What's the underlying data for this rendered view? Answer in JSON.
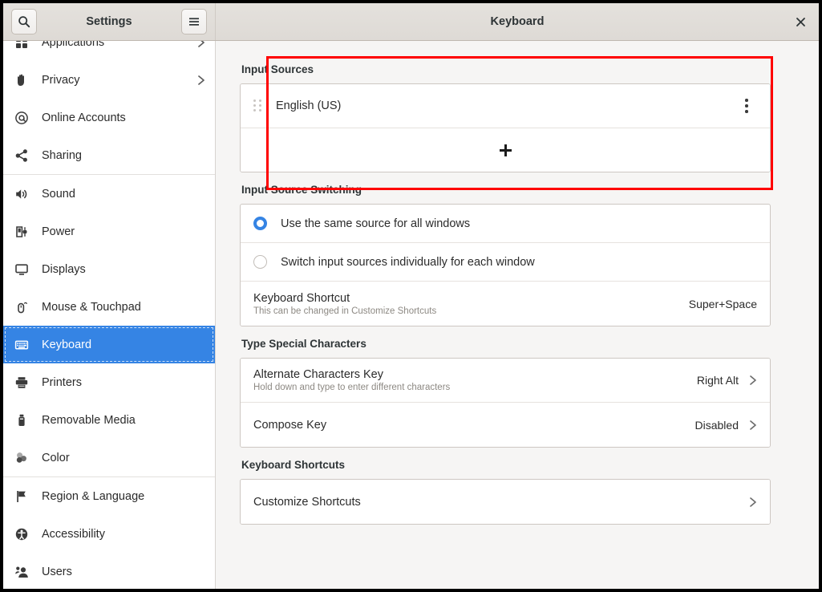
{
  "window": {
    "sidebar_header_title": "Settings",
    "content_header_title": "Keyboard",
    "search_icon": "search-icon",
    "menu_icon": "hamburger-menu-icon",
    "close_icon": "close-icon",
    "accent_color": "#3584e4",
    "highlight_color": "#ff0000"
  },
  "sidebar": {
    "items": [
      {
        "label": "Applications",
        "icon": "applications-icon",
        "chevron": "›",
        "selected": false,
        "clipped": true
      },
      {
        "label": "Privacy",
        "icon": "hand-privacy-icon",
        "chevron": "›",
        "selected": false
      },
      {
        "label": "Online Accounts",
        "icon": "at-sign-icon",
        "chevron": "",
        "selected": false
      },
      {
        "label": "Sharing",
        "icon": "share-nodes-icon",
        "chevron": "",
        "selected": false
      },
      {
        "label": "Sound",
        "icon": "speaker-icon",
        "chevron": "",
        "selected": false,
        "separator_before": true
      },
      {
        "label": "Power",
        "icon": "battery-power-icon",
        "chevron": "",
        "selected": false
      },
      {
        "label": "Displays",
        "icon": "display-monitor-icon",
        "chevron": "",
        "selected": false
      },
      {
        "label": "Mouse & Touchpad",
        "icon": "mouse-icon",
        "chevron": "",
        "selected": false
      },
      {
        "label": "Keyboard",
        "icon": "keyboard-icon",
        "chevron": "",
        "selected": true
      },
      {
        "label": "Printers",
        "icon": "printer-icon",
        "chevron": "",
        "selected": false
      },
      {
        "label": "Removable Media",
        "icon": "usb-drive-icon",
        "chevron": "",
        "selected": false
      },
      {
        "label": "Color",
        "icon": "color-circles-icon",
        "chevron": "",
        "selected": false
      },
      {
        "label": "Region & Language",
        "icon": "flag-icon",
        "chevron": "",
        "selected": false,
        "separator_before": true
      },
      {
        "label": "Accessibility",
        "icon": "accessibility-icon",
        "chevron": "",
        "selected": false
      },
      {
        "label": "Users",
        "icon": "users-icon",
        "chevron": "",
        "selected": false
      }
    ]
  },
  "main": {
    "input_sources": {
      "title": "Input Sources",
      "entries": [
        {
          "label": "English (US)",
          "drag_handle": "drag-handle-icon",
          "menu": "kebab-menu-icon"
        }
      ],
      "add_label": "+"
    },
    "input_source_switching": {
      "title": "Input Source Switching",
      "options": [
        {
          "label": "Use the same source for all windows",
          "checked": true
        },
        {
          "label": "Switch input sources individually for each window",
          "checked": false
        }
      ],
      "shortcut_row": {
        "title": "Keyboard Shortcut",
        "subtitle": "This can be changed in Customize Shortcuts",
        "value": "Super+Space"
      }
    },
    "type_special_characters": {
      "title": "Type Special Characters",
      "rows": [
        {
          "title": "Alternate Characters Key",
          "subtitle": "Hold down and type to enter different characters",
          "value": "Right Alt",
          "chevron": "›"
        },
        {
          "title": "Compose Key",
          "subtitle": "",
          "value": "Disabled",
          "chevron": "›"
        }
      ]
    },
    "keyboard_shortcuts": {
      "title": "Keyboard Shortcuts",
      "rows": [
        {
          "title": "Customize Shortcuts",
          "value": "",
          "chevron": "›"
        }
      ]
    }
  }
}
